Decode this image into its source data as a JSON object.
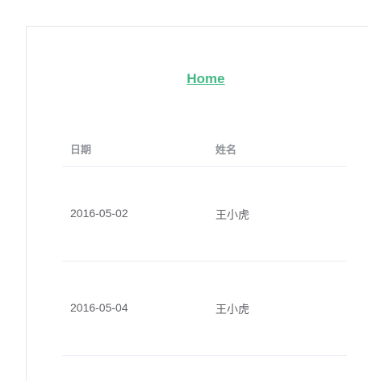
{
  "nav": {
    "home_label": "Home"
  },
  "table": {
    "columns": [
      "日期",
      "姓名"
    ],
    "rows": [
      [
        "2016-05-02",
        "王小虎"
      ],
      [
        "2016-05-04",
        "王小虎"
      ]
    ]
  },
  "colors": {
    "link": "#42b983",
    "header_text": "#909399",
    "cell_text": "#606266",
    "divider": "#ebeef5"
  }
}
